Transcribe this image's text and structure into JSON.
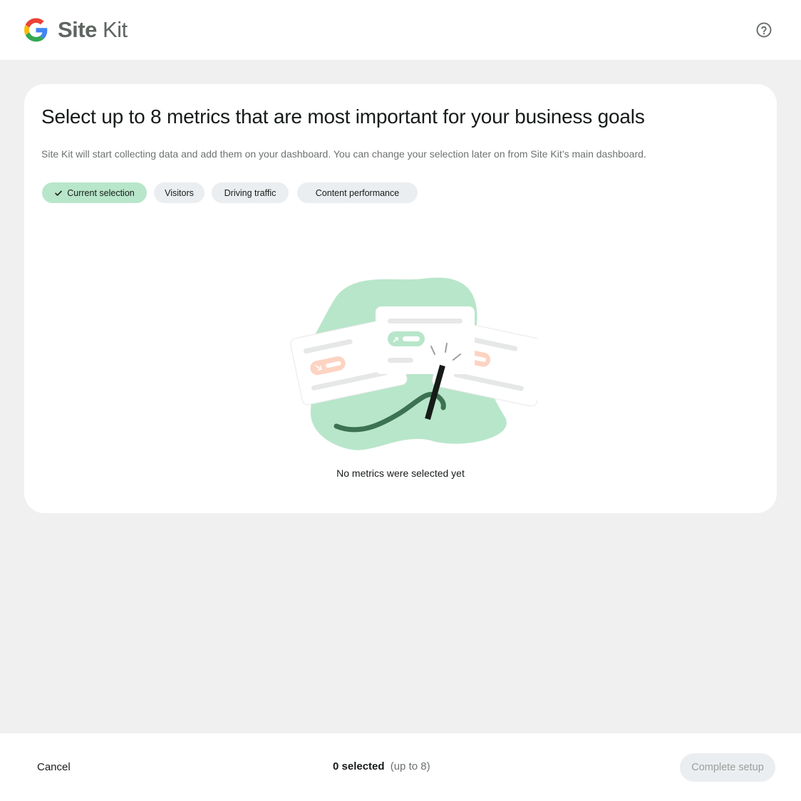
{
  "header": {
    "logo_word_bold": "Site",
    "logo_word_regular": "Kit",
    "help_icon": "help-circle-icon"
  },
  "main": {
    "title": "Select up to 8 metrics that are most important for your business goals",
    "subtitle": "Site Kit will start collecting data and add them on your dashboard. You can change your selection later on from Site Kit’s main dashboard.",
    "chips": [
      {
        "label": "Current selection",
        "active": true,
        "icon": "check-icon"
      },
      {
        "label": "Visitors",
        "active": false
      },
      {
        "label": "Driving traffic",
        "active": false
      },
      {
        "label": "Content performance",
        "active": false
      }
    ],
    "empty_state_text": "No metrics were selected yet"
  },
  "footer": {
    "cancel_label": "Cancel",
    "selected_count": "0 selected",
    "selected_limit": "(up to 8)",
    "complete_label": "Complete setup"
  },
  "colors": {
    "chip_active": "#b8e6ca",
    "chip_inactive": "#ebeef0",
    "illustration_green": "#b8e6ca",
    "illustration_dark_green": "#3c7251",
    "illustration_coral": "#fdd3c2"
  }
}
